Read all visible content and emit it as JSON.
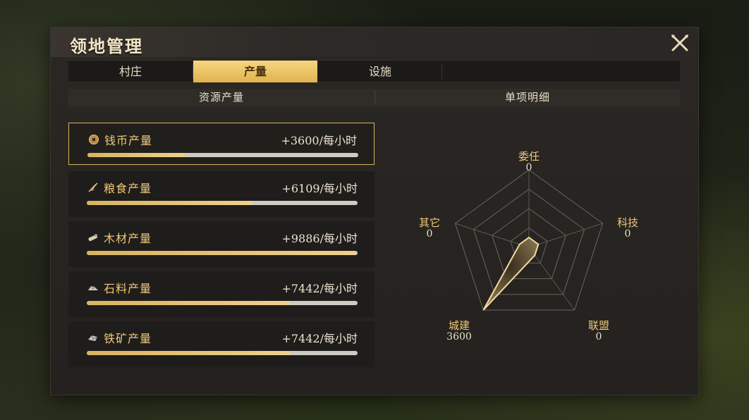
{
  "title": "领地管理",
  "tabs": [
    {
      "label": "村庄",
      "active": false
    },
    {
      "label": "产量",
      "active": true
    },
    {
      "label": "设施",
      "active": false
    }
  ],
  "subheader": {
    "left": "资源产量",
    "right": "单项明细"
  },
  "resources": [
    {
      "icon": "coin-icon",
      "name": "钱币产量",
      "value": "+3600/每小时",
      "fill": 0.36,
      "selected": true
    },
    {
      "icon": "grain-icon",
      "name": "粮食产量",
      "value": "+6109/每小时",
      "fill": 0.61,
      "selected": false
    },
    {
      "icon": "wood-icon",
      "name": "木材产量",
      "value": "+9886/每小时",
      "fill": 0.99,
      "selected": false
    },
    {
      "icon": "stone-icon",
      "name": "石料产量",
      "value": "+7442/每小时",
      "fill": 0.75,
      "selected": false
    },
    {
      "icon": "iron-icon",
      "name": "铁矿产量",
      "value": "+7442/每小时",
      "fill": 0.75,
      "selected": false
    }
  ],
  "chart_data": {
    "type": "radar",
    "axes": [
      {
        "label": "委任",
        "value": 0
      },
      {
        "label": "科技",
        "value": 0
      },
      {
        "label": "联盟",
        "value": 0
      },
      {
        "label": "城建",
        "value": 3600
      },
      {
        "label": "其它",
        "value": 0
      }
    ],
    "max": 3600
  },
  "colors": {
    "accent": "#f0c87a",
    "tab_active": "#e9c262",
    "bar_fill": "#e4c06f"
  }
}
